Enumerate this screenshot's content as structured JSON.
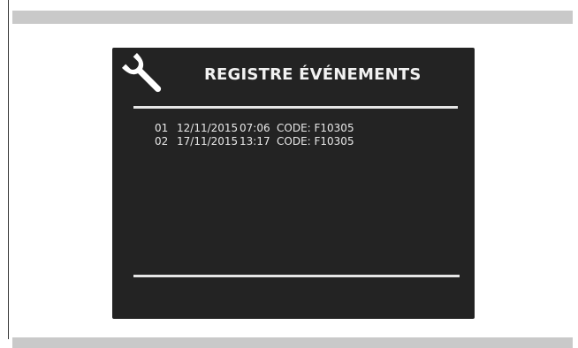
{
  "screen": {
    "title": "REGISTRE ÉVÉNEMENTS",
    "title_icon": "wrench-icon",
    "events": [
      {
        "number": "01",
        "date": "12/11/2015",
        "time": "07:06",
        "code": "CODE: F10305"
      },
      {
        "number": "02",
        "date": "17/11/2015",
        "time": "13:17",
        "code": "CODE: F10305"
      }
    ]
  },
  "colors": {
    "screen_background": "#232323",
    "text": "#f2f2f2",
    "band": "#c9c9c9"
  }
}
